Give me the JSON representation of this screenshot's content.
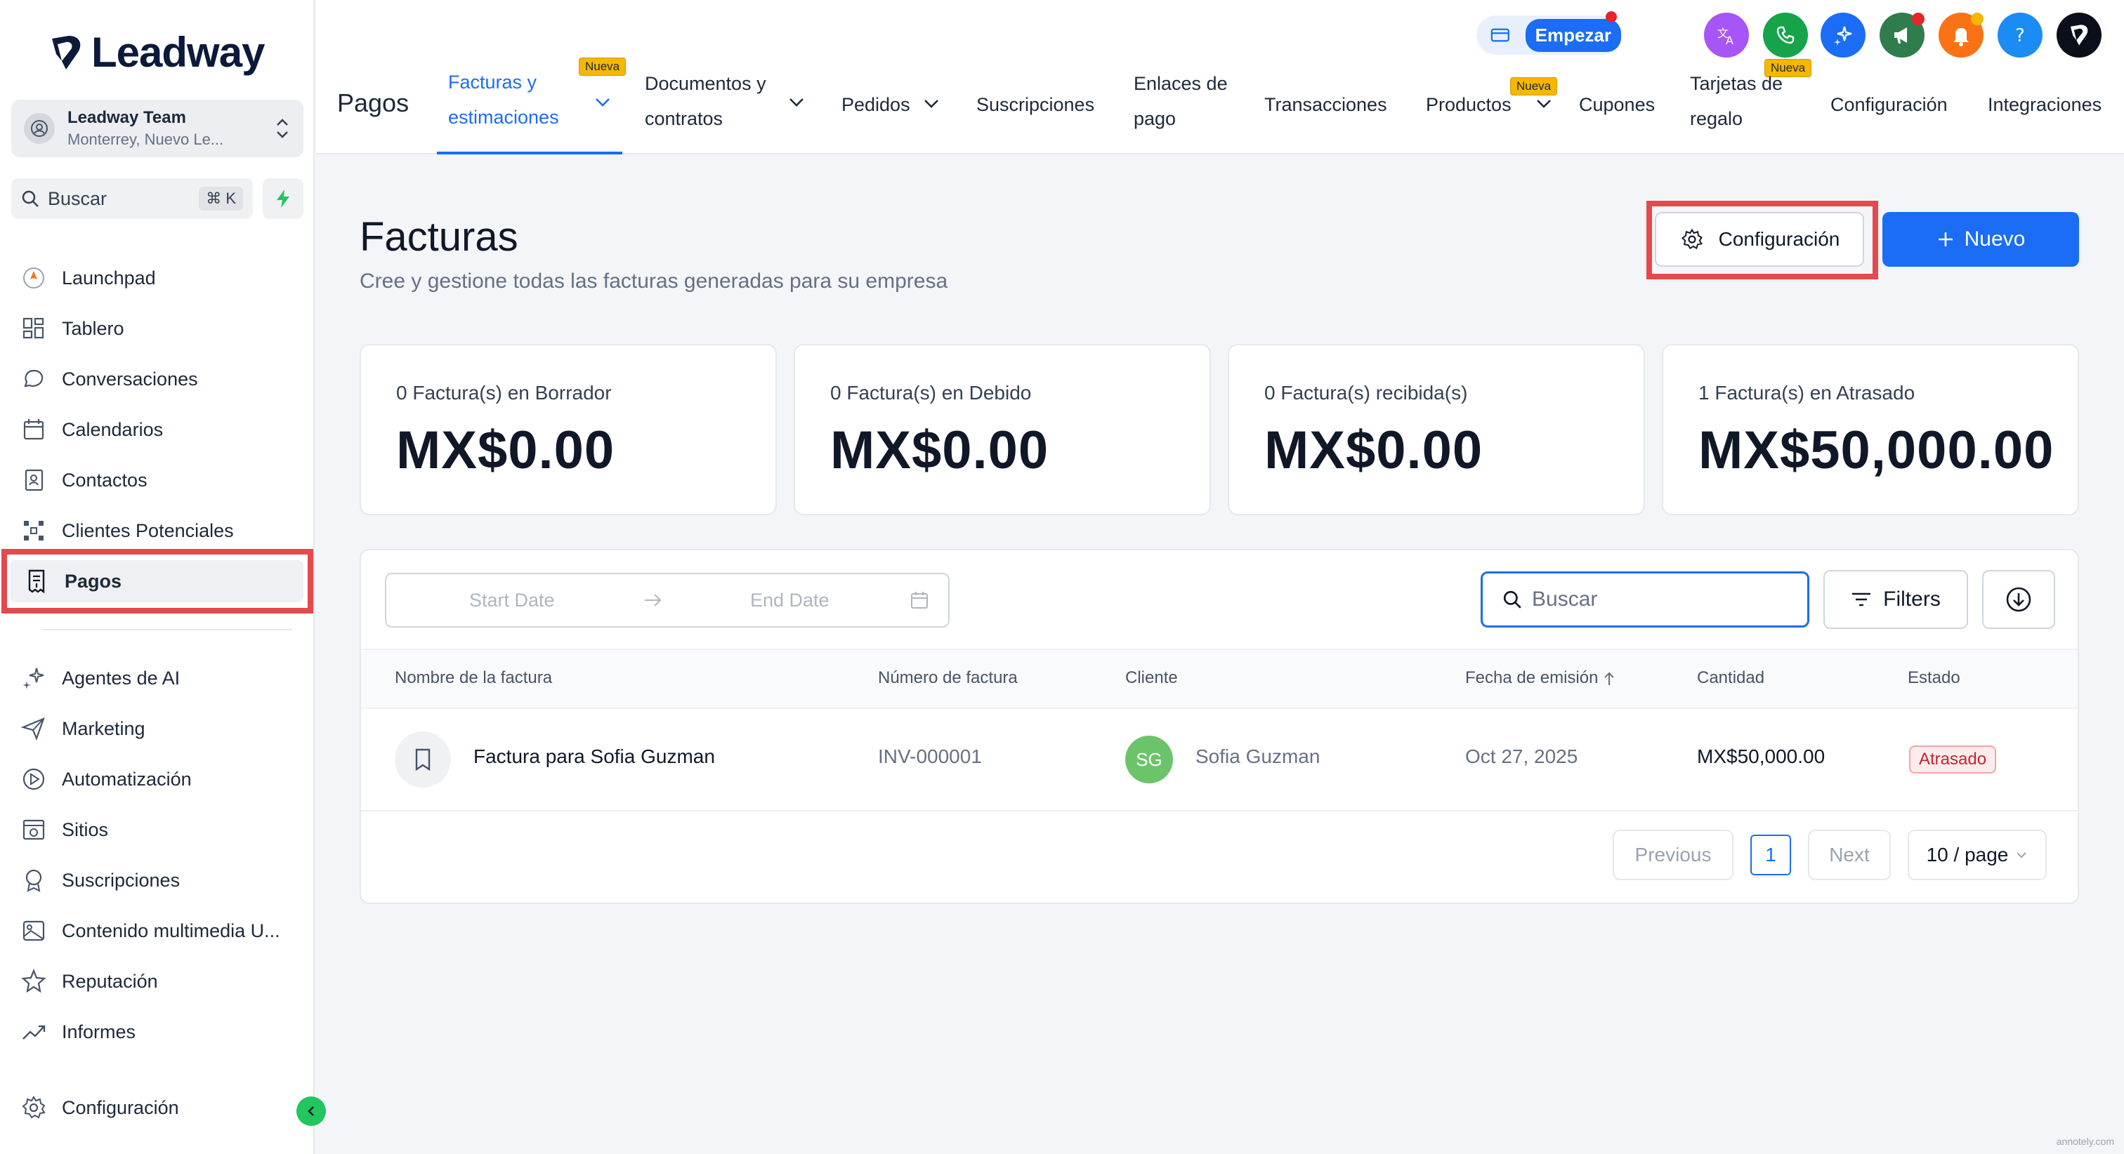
{
  "brand": {
    "name": "Leadway"
  },
  "account": {
    "name": "Leadway Team",
    "location": "Monterrey, Nuevo Le..."
  },
  "sidebar": {
    "search_label": "Buscar",
    "search_shortcut": "⌘ K",
    "items": [
      {
        "label": "Launchpad",
        "icon": "rocket-icon"
      },
      {
        "label": "Tablero",
        "icon": "grid-icon"
      },
      {
        "label": "Conversaciones",
        "icon": "chat-icon"
      },
      {
        "label": "Calendarios",
        "icon": "calendar-icon"
      },
      {
        "label": "Contactos",
        "icon": "contacts-icon"
      },
      {
        "label": "Clientes Potenciales",
        "icon": "pipeline-icon"
      },
      {
        "label": "Pagos",
        "icon": "receipt-icon"
      },
      {
        "label": "Agentes de AI",
        "icon": "sparkle-icon"
      },
      {
        "label": "Marketing",
        "icon": "send-icon"
      },
      {
        "label": "Automatización",
        "icon": "automation-icon"
      },
      {
        "label": "Sitios",
        "icon": "site-icon"
      },
      {
        "label": "Suscripciones",
        "icon": "award-icon"
      },
      {
        "label": "Contenido multimedia U...",
        "icon": "image-icon"
      },
      {
        "label": "Reputación",
        "icon": "star-icon"
      },
      {
        "label": "Informes",
        "icon": "trend-icon"
      },
      {
        "label": "Configuración",
        "icon": "gear-icon"
      }
    ],
    "active": "Pagos"
  },
  "header": {
    "empezar_label": "Empezar",
    "section_title": "Pagos",
    "new_badge": "Nueva",
    "tabs": [
      {
        "line1": "Facturas y",
        "line2": "estimaciones"
      },
      {
        "line1": "Documentos y",
        "line2": "contratos"
      },
      {
        "line1": "Pedidos",
        "line2": ""
      },
      {
        "line1": "Suscripciones",
        "line2": ""
      },
      {
        "line1": "Enlaces de",
        "line2": "pago"
      },
      {
        "line1": "Transacciones",
        "line2": ""
      },
      {
        "line1": "Productos",
        "line2": ""
      },
      {
        "line1": "Cupones",
        "line2": ""
      },
      {
        "line1": "Tarjetas de",
        "line2": "regalo"
      },
      {
        "line1": "Configuración",
        "line2": ""
      },
      {
        "line1": "Integraciones",
        "line2": ""
      }
    ]
  },
  "page": {
    "title": "Facturas",
    "subtitle": "Cree y gestione todas las facturas generadas para su empresa",
    "config_button": "Configuración",
    "new_button": "Nuevo"
  },
  "stats": [
    {
      "label": "0 Factura(s) en Borrador",
      "value": "MX$0.00"
    },
    {
      "label": "0 Factura(s) en Debido",
      "value": "MX$0.00"
    },
    {
      "label": "0 Factura(s) recibida(s)",
      "value": "MX$0.00"
    },
    {
      "label": "1 Factura(s) en Atrasado",
      "value": "MX$50,000.00"
    }
  ],
  "table": {
    "start_date_placeholder": "Start Date",
    "end_date_placeholder": "End Date",
    "search_placeholder": "Buscar",
    "filters_label": "Filters",
    "columns": [
      "Nombre de la factura",
      "Número de factura",
      "Cliente",
      "Fecha de emisión",
      "Cantidad",
      "Estado"
    ],
    "rows": [
      {
        "name": "Factura para Sofia Guzman",
        "number": "INV-000001",
        "client_initials": "SG",
        "client": "Sofia Guzman",
        "date": "Oct 27, 2025",
        "amount": "MX$50,000.00",
        "status": "Atrasado"
      }
    ],
    "pagination": {
      "previous": "Previous",
      "current_page": "1",
      "next": "Next",
      "per_page": "10 / page"
    }
  },
  "watermark": "annotely.com",
  "colors": {
    "accent": "#1a6df4",
    "highlight": "#e5484d",
    "overdue": "#c0272d"
  }
}
